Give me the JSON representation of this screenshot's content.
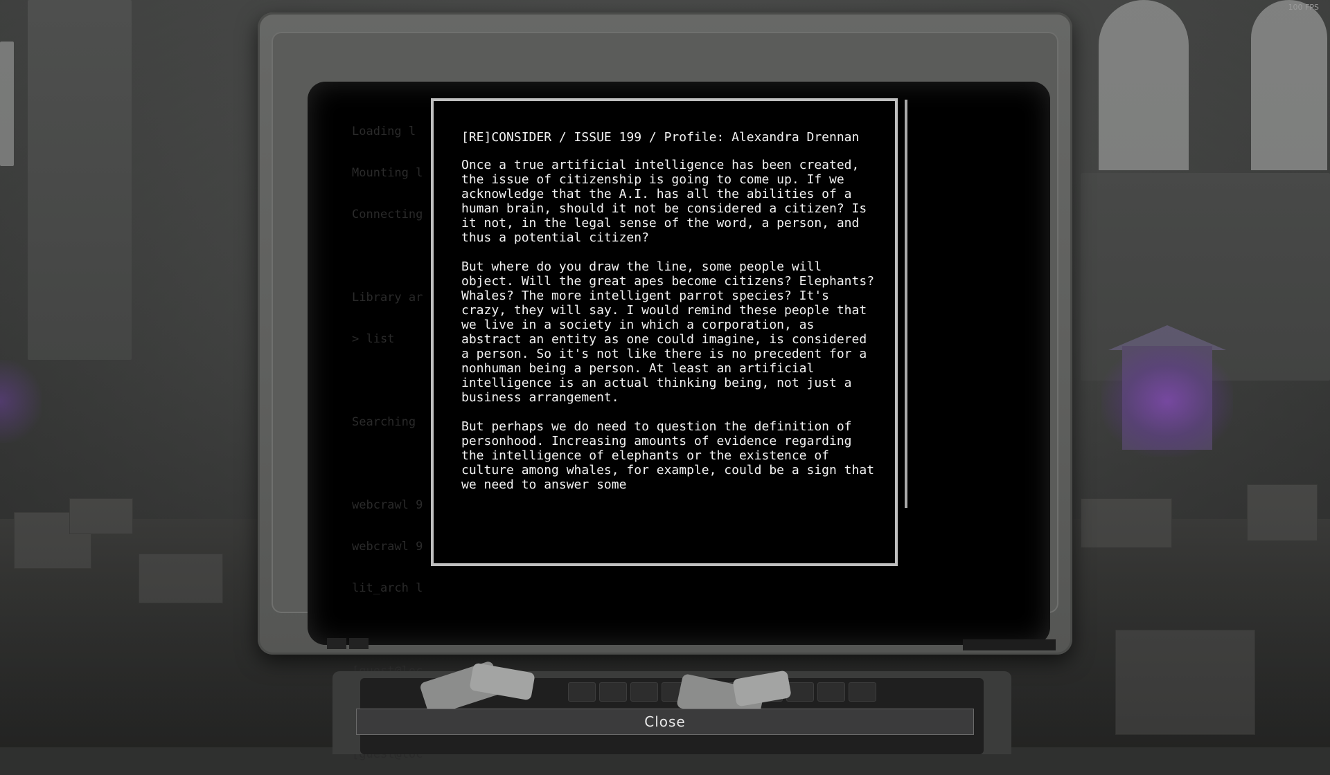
{
  "hud": {
    "fps": "100 FPS"
  },
  "terminal_background": [
    "Loading l",
    "Mounting l",
    "Connecting",
    "",
    "Library ar",
    "> list",
    "",
    "Searching",
    "",
    "webcrawl 9",
    "webcrawl 9",
    "lit_arch l",
    "",
    "[guest@loc",
    "",
    "[guest@loc"
  ],
  "document": {
    "title": "[RE]CONSIDER / ISSUE 199 / Profile: Alexandra Drennan",
    "paragraphs": [
      "Once a true artificial intelligence has been created, the issue of citizenship is going to come up. If we acknowledge that the A.I. has all the abilities of a human brain, should it not be considered a citizen? Is it not, in the legal sense of the word, a person, and thus a potential citizen?",
      "But where do you draw the line, some people will object. Will the great apes become citizens? Elephants? Whales? The more intelligent parrot species? It's crazy, they will say. I would remind these people that we live in a society in which a corporation, as abstract an entity as one could imagine, is considered a person. So it's not like there is no precedent for a nonhuman being a person. At least an artificial intelligence is an actual thinking being, not just a business arrangement.",
      "But perhaps we do need to question the definition of personhood. Increasing amounts of evidence regarding the intelligence of elephants or the existence of culture among whales, for example, could be a sign that we need to answer some"
    ]
  },
  "close_button": {
    "label": "Close"
  },
  "colors": {
    "screen_text": "#f2f2f2",
    "screen_bg": "#000000",
    "frame": "#bfbfbf",
    "monitor": "#5e5f5d",
    "purple_light": "#8c46c8"
  }
}
